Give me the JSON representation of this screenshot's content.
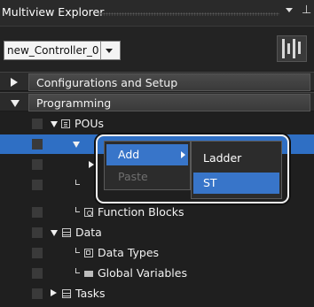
{
  "window": {
    "title": "Multiview Explorer"
  },
  "controller": {
    "selected": "new_Controller_0"
  },
  "tree": {
    "configurations_label": "Configurations and Setup",
    "programming_label": "Programming",
    "pous_label": "POUs",
    "function_blocks_label": "Function Blocks",
    "data_label": "Data",
    "data_types_label": "Data Types",
    "global_variables_label": "Global Variables",
    "tasks_label": "Tasks"
  },
  "context_menu": {
    "items": [
      {
        "label": "Add",
        "enabled": true,
        "has_submenu": true
      },
      {
        "label": "Paste",
        "enabled": false
      }
    ],
    "submenu": [
      {
        "label": "Ladder"
      },
      {
        "label": "ST",
        "highlighted": true
      }
    ]
  },
  "colors": {
    "selection": "#2f6fc4",
    "menu_highlight": "#3875c9",
    "background": "#1f1f1f"
  },
  "icons": [
    "pin-icon",
    "dropdown-arrow-icon",
    "controller-icon",
    "pou-icon",
    "function-block-icon",
    "data-icon",
    "data-types-icon",
    "global-variables-icon",
    "tasks-icon",
    "submenu-arrow-icon"
  ]
}
